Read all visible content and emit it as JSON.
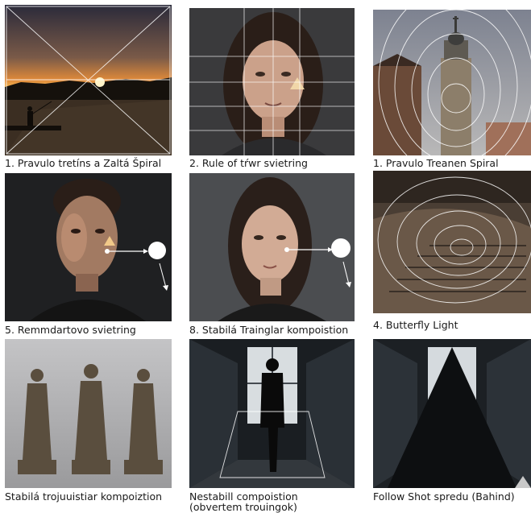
{
  "captions": [
    "1. Pravulo tretíns a Zaltá Špiral",
    "2. Rule of tŕwr svietring",
    "1. Pravulo Treanen Spiral",
    "5. Remmdartovo svietring",
    "8. Stabilá Trainglar kompoistion",
    "4. Butterfly Light",
    "Stabilá trojuuistiar kompoiztion",
    "Nestabill compoistion",
    "(obvertem trouingok)",
    "Follow Shot spredu (Bahind)"
  ],
  "panels": [
    {
      "subject": "sunset lake silhouette",
      "overlay": "rule of thirds with diagonals"
    },
    {
      "subject": "woman portrait",
      "overlay": "grid with triangle highlight"
    },
    {
      "subject": "baroque tower",
      "overlay": "concentric ellipses"
    },
    {
      "subject": "man portrait",
      "overlay": "Rembrandt triangle with light source"
    },
    {
      "subject": "woman portrait dark",
      "overlay": "light source arrow"
    },
    {
      "subject": "spiral staircase",
      "overlay": "concentric ellipses"
    },
    {
      "subject": "three statues",
      "overlay": "none"
    },
    {
      "subject": "figure in corridor",
      "overlay": "inverted triangle"
    },
    {
      "subject": "corridor",
      "overlay": "large triangle"
    }
  ]
}
